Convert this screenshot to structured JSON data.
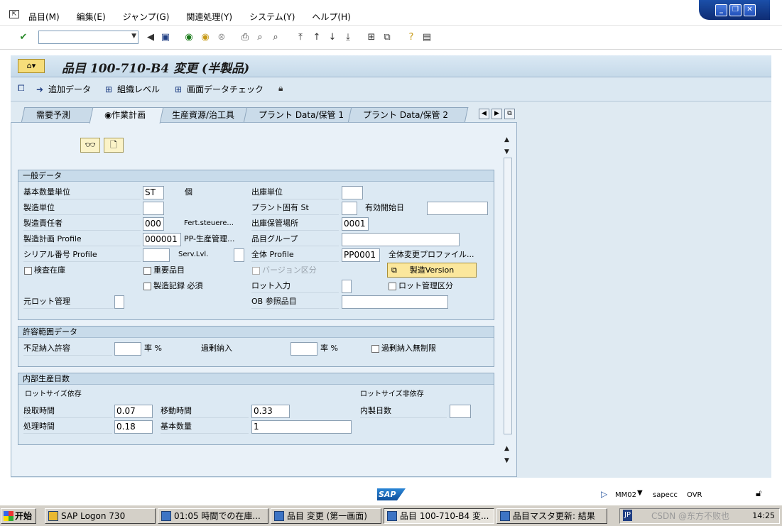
{
  "menu": [
    "品目(M)",
    "編集(E)",
    "ジャンプ(G)",
    "関連処理(Y)",
    "システム(Y)",
    "ヘルプ(H)"
  ],
  "window_controls": [
    "minimize-icon",
    "restore-icon",
    "close-icon"
  ],
  "title": "品目 100-710-B4 変更 (半製品)",
  "app_toolbar": {
    "add_data": "追加データ",
    "org_level": "組織レベル",
    "check_screen": "画面データチェック"
  },
  "tabs": [
    "需要予測",
    "作業計画",
    "生産資源/治工具",
    "プラント Data/保管 1",
    "プラント Data/保管 2"
  ],
  "active_tab": "作業計画",
  "general": {
    "title": "一般データ",
    "base_uom_label": "基本数量単位",
    "base_uom_value": "ST",
    "base_uom_text": "個",
    "issue_unit_label": "出庫単位",
    "prod_unit_label": "製造単位",
    "plant_status_label": "プラント固有 St",
    "valid_from_label": "有効開始日",
    "prod_supervisor_label": "製造責任者",
    "prod_supervisor_value": "000",
    "fert_label": "Fert.steuere...",
    "issue_sloc_label": "出庫保管場所",
    "issue_sloc_value": "0001",
    "prod_profile_label": "製造計画 Profile",
    "prod_profile_value": "000001",
    "prod_profile_text": "PP-生産管理...",
    "material_group_label": "品目グループ",
    "serial_profile_label": "シリアル番号 Profile",
    "serv_lvl_label": "Serv.Lvl.",
    "overall_profile_label": "全体 Profile",
    "overall_profile_value": "PP0001",
    "overall_change_profile_label": "全体変更プロファイル...",
    "insp_stock_label": "検査在庫",
    "critical_part_label": "重要品目",
    "version_indicator_label": "バージョン区分",
    "prod_version_button": "製造Version",
    "batch_record_label": "製造記録 必須",
    "batch_entry_label": "ロット入力",
    "batch_mgmt_label": "ロット管理区分",
    "orig_batch_label": "元ロット管理",
    "ob_ref_label": "OB 参照品目"
  },
  "tolerance": {
    "title": "許容範囲データ",
    "under_label": "不足納入許容",
    "pct1": "率 %",
    "over_label": "過剰納入",
    "pct2": "率 %",
    "unlimited_label": "過剰納入無制限"
  },
  "inhouse": {
    "title": "内部生産日数",
    "lot_dep": "ロットサイズ依存",
    "lot_indep": "ロットサイズ非依存",
    "setup_label": "段取時間",
    "setup_value": "0.07",
    "interop_label": "移動時間",
    "interop_value": "0.33",
    "inhouse_label": "内製日数",
    "proc_label": "処理時間",
    "proc_value": "0.18",
    "base_qty_label": "基本数量",
    "base_qty_value": "1"
  },
  "status": {
    "logo": "SAP",
    "tcode": "MM02",
    "server": "sapecc",
    "mode": "OVR"
  },
  "taskbar": {
    "start": "开始",
    "tasks": [
      "SAP Logon 730",
      "01:05 時間での在庫...",
      "品目 変更 (第一画面)",
      "品目 100-710-B4 変...",
      "品目マスタ更新: 結果"
    ],
    "ime": "JP",
    "time": "14:25",
    "watermark": "CSDN @东方不败也"
  }
}
